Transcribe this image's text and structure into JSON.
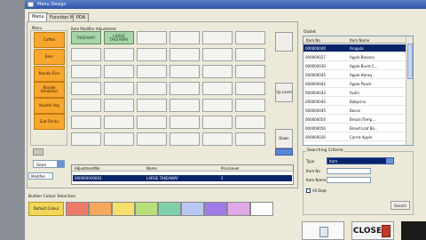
{
  "window": {
    "title": "Menu Design"
  },
  "tabs": [
    "Menu",
    "Function M",
    "PDA"
  ],
  "menu": {
    "label": "Menu",
    "buttons": [
      "Coffee",
      "Beer",
      "Noodle Rice",
      "Noodle Breakfast",
      "Noodle Veg",
      "Sub Drinks"
    ]
  },
  "grid": {
    "label": "Item Modifier Adjustment",
    "filled": [
      "TAKEAWAY",
      "LARGE TAKEAWAY"
    ],
    "side_buttons": {
      "level": "Up Level",
      "down": "Down"
    }
  },
  "nav": {
    "down_label": "Down",
    "selector_value": "Modifier"
  },
  "adjustment": {
    "headers": [
      "AdjustmentNo",
      "Name",
      "PriceLevel"
    ],
    "row": [
      "000000000003",
      "LARGE TAKEAWAY",
      "2"
    ]
  },
  "colour": {
    "label": "Button Colour Selection",
    "default_label": "Default Colour",
    "swatches": [
      "#f07a6a",
      "#f3a85a",
      "#f4e06a",
      "#b8e07a",
      "#7fd0a8",
      "#b8c8f0",
      "#a07ae8",
      "#e0a8e8",
      "#ffffff"
    ]
  },
  "outlet": {
    "label": "Outlet",
    "headers": [
      "Item No",
      "Item Name"
    ],
    "rows": [
      [
        "000000040",
        "Arugula"
      ],
      [
        "000000027",
        "Apple Banana"
      ],
      [
        "000000030",
        "Apple Burnt C..."
      ],
      [
        "000000045",
        "Apple Honey"
      ],
      [
        "000000042",
        "Apple Peach"
      ],
      [
        "000000043",
        "Asahi"
      ],
      [
        "000000044",
        "Babycino"
      ],
      [
        "000000045",
        "Bacon"
      ],
      [
        "000000054",
        "Bread (Temp..."
      ],
      [
        "000000056",
        "Bread Loaf Bo..."
      ],
      [
        "000000026",
        "Carrot Apple"
      ]
    ]
  },
  "criteria": {
    "label": "Searching Criteria",
    "type_label": "Type",
    "type_value": "Item",
    "item_no_label": "Item No",
    "item_name_label": "Item Name",
    "all_dept_label": "All Dept",
    "search_label": "Search"
  },
  "footer": {
    "close_label": "CLOSE"
  }
}
